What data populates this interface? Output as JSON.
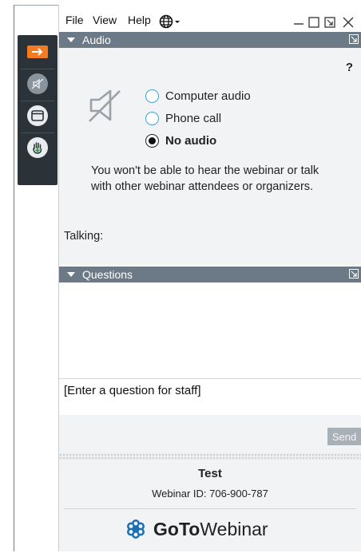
{
  "menu": {
    "file": "File",
    "view": "View",
    "help": "Help"
  },
  "audio_panel": {
    "title": "Audio",
    "help": "?",
    "options": [
      {
        "label": "Computer audio",
        "selected": false
      },
      {
        "label": "Phone call",
        "selected": false
      },
      {
        "label": "No audio",
        "selected": true
      }
    ],
    "message": "You won't be able to hear the webinar or talk with other webinar attendees or organizers.",
    "talking_label": "Talking:"
  },
  "questions_panel": {
    "title": "Questions",
    "input_value": "[Enter a question for staff]",
    "send_label": "Send"
  },
  "footer": {
    "webinar_title": "Test",
    "webinar_id": "Webinar ID: 706-900-787",
    "brand_go": "Go",
    "brand_to": "To",
    "brand_webinar": "Webinar"
  },
  "colors": {
    "header_bg": "#6c7a87",
    "accent_orange": "#f47a22",
    "radio_blue": "#3aa5d6",
    "brand_blue": "#1b6fb5",
    "panel_bg": "#f1f3f4",
    "strip_bg": "#2b3238"
  },
  "icons": {
    "arrow": "arrow-right-icon",
    "audio_off": "audio-muted-icon",
    "screen": "window-icon",
    "hand": "raise-hand-icon",
    "globe": "globe-icon",
    "speaker": "speaker-muted-icon"
  }
}
